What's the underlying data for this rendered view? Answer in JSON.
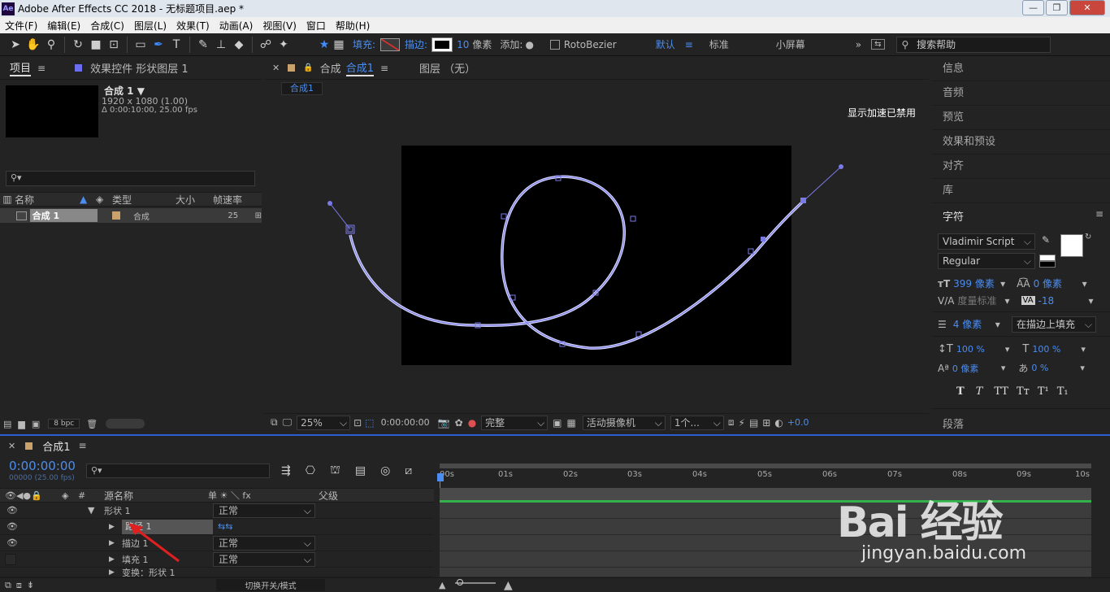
{
  "titlebar": {
    "app_icon": "Ae",
    "title": "Adobe After Effects CC 2018 - 无标题项目.aep *",
    "min": "—",
    "max": "❐",
    "close": "✕"
  },
  "menu": [
    "文件(F)",
    "编辑(E)",
    "合成(C)",
    "图层(L)",
    "效果(T)",
    "动画(A)",
    "视图(V)",
    "窗口",
    "帮助(H)"
  ],
  "toolbar": {
    "fill_label": "填充:",
    "stroke_label": "描边:",
    "stroke_width": "10",
    "stroke_unit": "像素",
    "add_label": "添加:",
    "rotobezier_label": "RotoBezier",
    "workspace_default": "默认",
    "workspace_standard": "标准",
    "workspace_small": "小屏幕",
    "search_placeholder": "搜索帮助"
  },
  "project": {
    "tab_project": "项目",
    "tab_effects": "效果控件 形状图层 1",
    "comp_name": "合成 1 ▼",
    "comp_size": "1920 x 1080 (1.00)",
    "comp_duration": "Δ 0:00:10:00, 25.00 fps",
    "columns": {
      "name": "名称",
      "type": "类型",
      "size": "大小",
      "fps": "帧速率"
    },
    "items": [
      {
        "name": "合成 1",
        "type": "合成",
        "fps": "25"
      }
    ],
    "bpc": "8 bpc"
  },
  "viewer": {
    "tab_comp": "合成",
    "tab_comp_name": "合成1",
    "tab_layer": "图层 （无）",
    "breadcrumb": "合成1",
    "notice": "显示加速已禁用",
    "zoom": "25%",
    "timecode": "0:00:00:00",
    "resolution": "完整",
    "camera": "活动摄像机",
    "views": "1个...",
    "exposure": "+0.0"
  },
  "right": {
    "panels": [
      "信息",
      "音频",
      "预览",
      "效果和预设",
      "对齐",
      "库"
    ],
    "character_title": "字符",
    "font": "Vladimir Script",
    "style": "Regular",
    "font_size": "399 像素",
    "leading": "0 像素",
    "kerning": "度量标准",
    "tracking": "-18",
    "stroke_width": "4 像素",
    "stroke_mode": "在描边上填充",
    "vscale": "100 %",
    "hscale": "100 %",
    "baseline": "0 像素",
    "tsume": "0 %",
    "paragraph_title": "段落"
  },
  "timeline": {
    "tab": "合成1",
    "timecode": "0:00:00:00",
    "frames": "00000 (25.00 fps)",
    "col_source": "源名称",
    "col_switches": "单 ☀ ＼ fx",
    "col_parent": "父级",
    "ruler": [
      "00s",
      "01s",
      "02s",
      "03s",
      "04s",
      "05s",
      "06s",
      "07s",
      "08s",
      "09s",
      "10s"
    ],
    "layers": [
      {
        "name": "形状 1",
        "mode": "正常"
      },
      {
        "name": "路径 1",
        "mode": ""
      },
      {
        "name": "描边 1",
        "mode": "正常"
      },
      {
        "name": "填充 1",
        "mode": "正常"
      },
      {
        "name": "变换：形状 1",
        "mode": ""
      }
    ],
    "toggle_label": "切换开关/模式"
  },
  "watermark": {
    "logo": "Bai 经验",
    "url": "jingyan.baidu.com"
  }
}
